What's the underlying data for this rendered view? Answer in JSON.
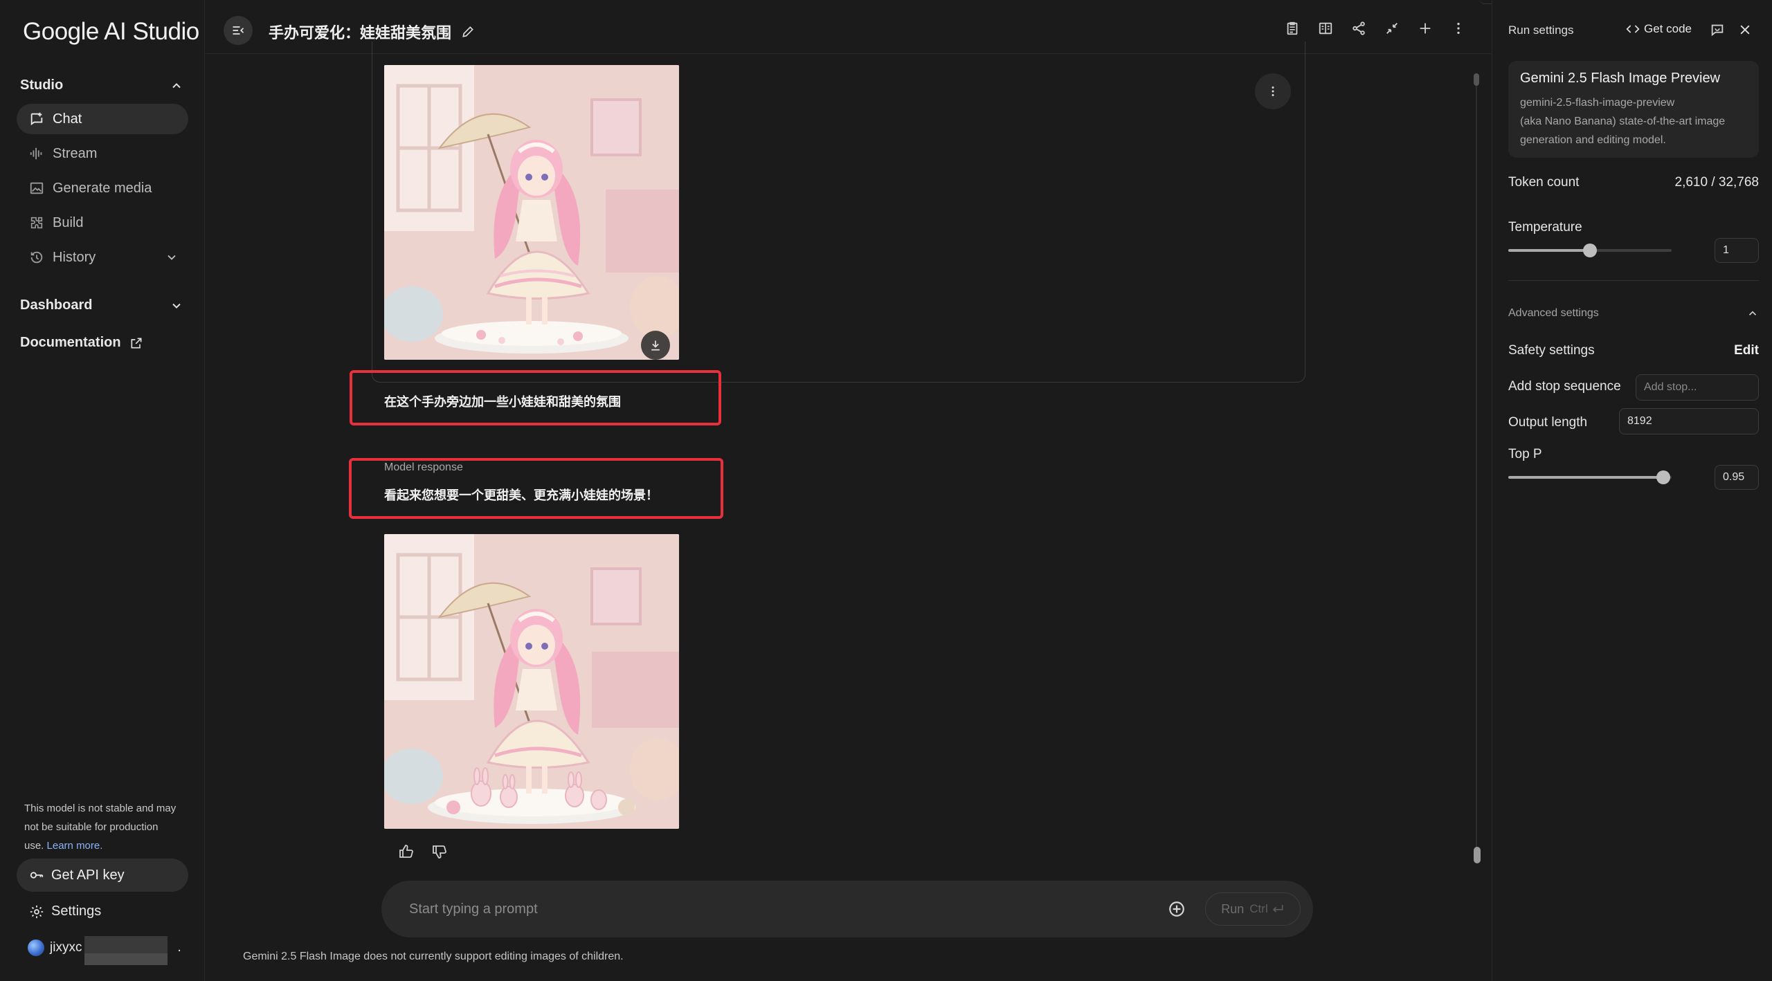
{
  "sidebar": {
    "brand": "Google AI Studio",
    "studio_label": "Studio",
    "nav": [
      {
        "label": "Chat",
        "icon": "chat-icon",
        "active": true
      },
      {
        "label": "Stream",
        "icon": "stream-icon"
      },
      {
        "label": "Generate media",
        "icon": "image-icon"
      },
      {
        "label": "Build",
        "icon": "build-icon"
      },
      {
        "label": "History",
        "icon": "history-icon"
      }
    ],
    "dashboard_label": "Dashboard",
    "documentation_label": "Documentation",
    "notice_text": "This model is not stable and may not be suitable for production use.",
    "notice_link": "Learn more.",
    "api_key_label": "Get API key",
    "settings_label": "Settings",
    "user_name": "jixyxc",
    "user_suffix": "."
  },
  "main": {
    "chat_title": "手办可爱化：娃娃甜美氛围",
    "user_prompt": "在这个手办旁边加一些小娃娃和甜美的氛围",
    "model_response_label": "Model response",
    "model_response_text": "看起来您想要一个更甜美、更充满小娃娃的场景！",
    "prompt_placeholder": "Start typing a prompt",
    "run_label": "Run",
    "run_shortcut": "Ctrl",
    "disclaimer": "Gemini 2.5 Flash Image does not currently support editing images of children.",
    "highlight_color": "#e8303d"
  },
  "panel": {
    "title": "Run settings",
    "get_code_label": "Get code",
    "model": {
      "name": "Gemini 2.5 Flash Image Preview",
      "id": "gemini-2.5-flash-image-preview",
      "description": "(aka Nano Banana) state-of-the-art image generation and editing model."
    },
    "token_count_label": "Token count",
    "token_count_value": "2,610 / 32,768",
    "temperature_label": "Temperature",
    "temperature_value": "1",
    "temperature_fraction": 0.5,
    "advanced_label": "Advanced settings",
    "safety_label": "Safety settings",
    "safety_edit": "Edit",
    "stop_label": "Add stop sequence",
    "stop_placeholder": "Add stop...",
    "output_length_label": "Output length",
    "output_length_value": "8192",
    "top_p_label": "Top P",
    "top_p_value": "0.95",
    "top_p_fraction": 0.95
  }
}
